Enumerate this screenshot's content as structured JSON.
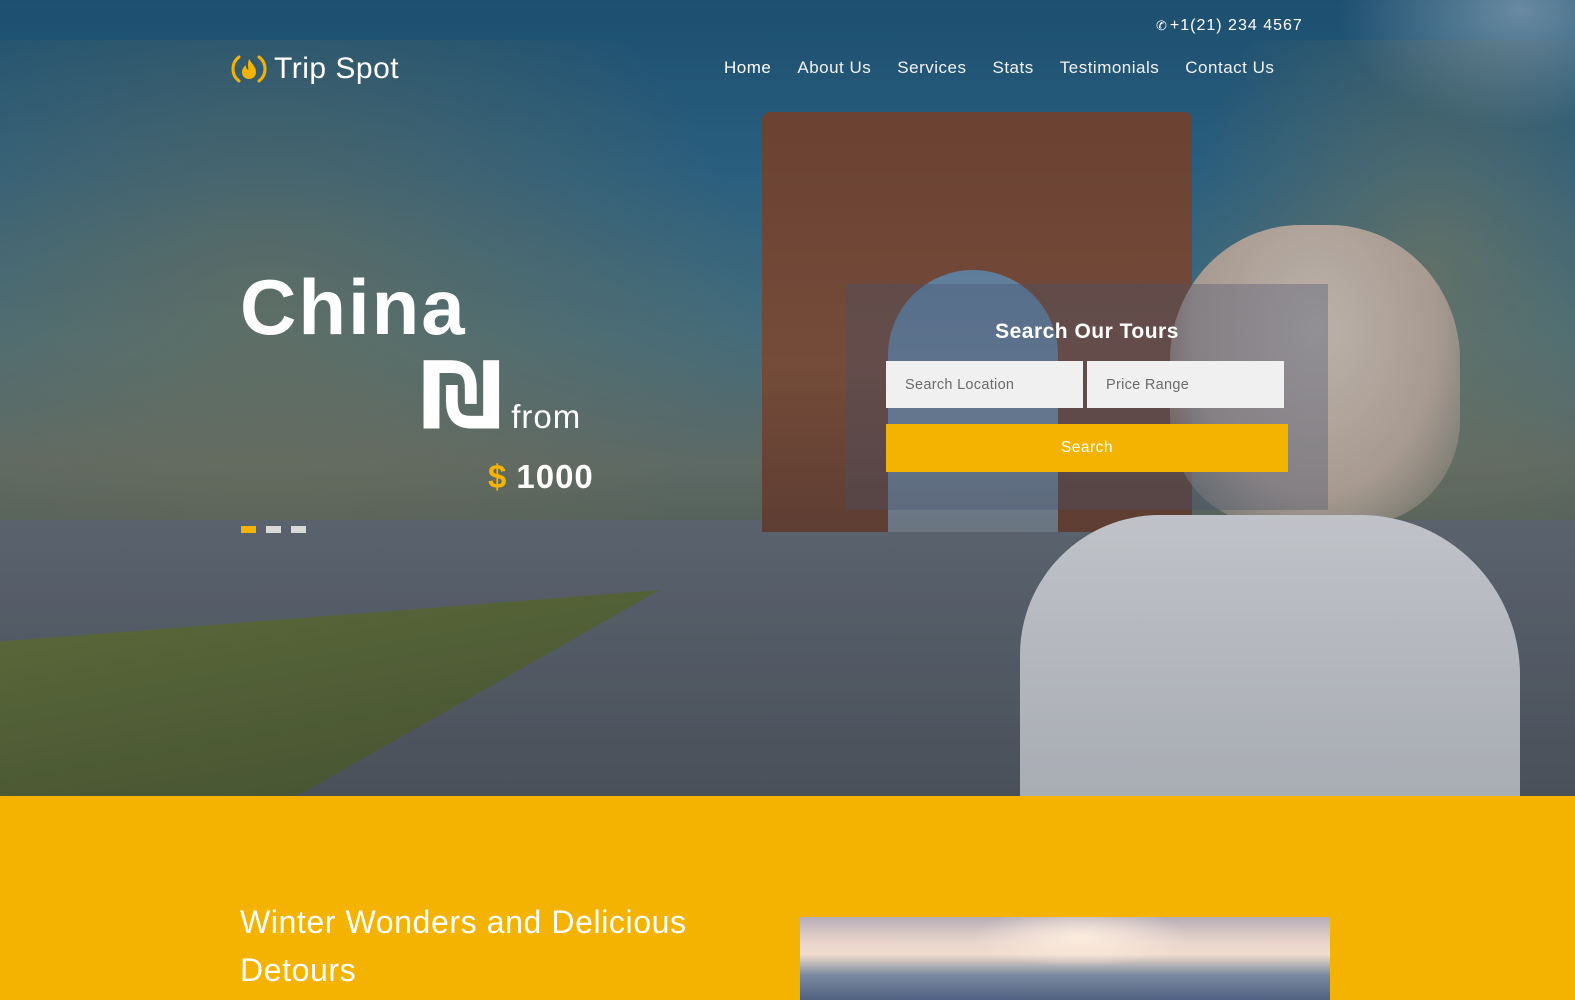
{
  "header": {
    "phone": "+1(21) 234 4567",
    "phone_icon": "phone-icon",
    "logo_text": "Trip Spot",
    "logo_icon": "fire-icon",
    "nav": [
      "Home",
      "About Us",
      "Services",
      "Stats",
      "Testimonials",
      "Contact Us"
    ],
    "active_nav": "Home"
  },
  "hero": {
    "destination": "China",
    "glyph": "₪",
    "from_label": "from",
    "currency_symbol": "$",
    "price": "1000",
    "slides": 3,
    "active_slide": 1
  },
  "search": {
    "title": "Search Our Tours",
    "location_placeholder": "Search Location",
    "price_placeholder": "Price Range",
    "button_label": "Search"
  },
  "feature": {
    "title": "Winter Wonders and Delicious Detours"
  },
  "colors": {
    "accent": "#f3b300",
    "text_light": "#ffffff"
  }
}
